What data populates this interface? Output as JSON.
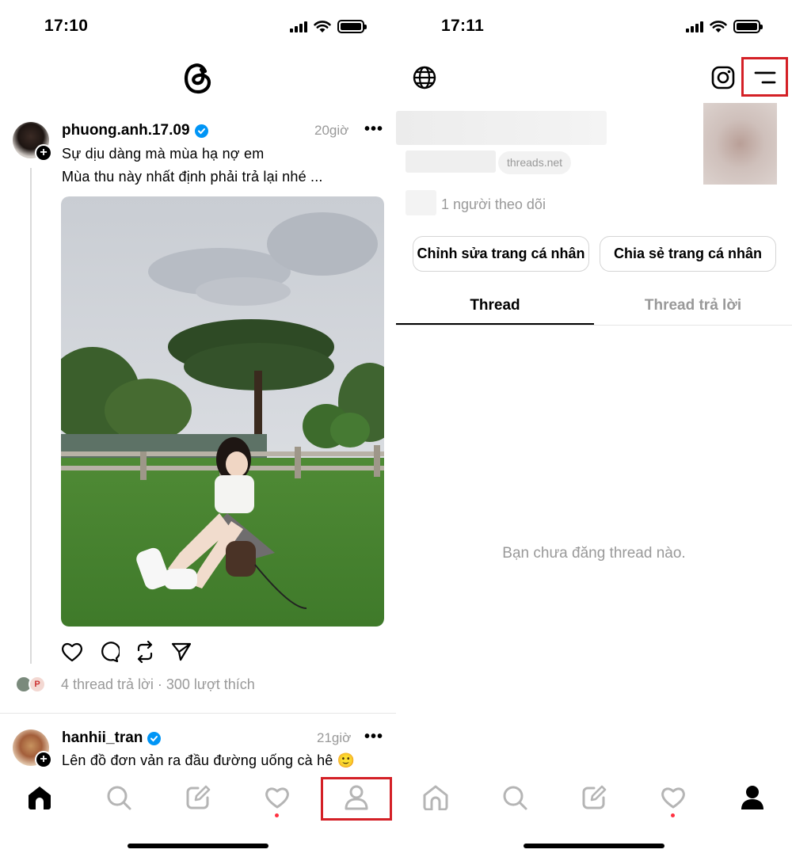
{
  "left": {
    "status_time": "17:10",
    "post1": {
      "username": "phuong.anh.17.09",
      "time": "20giờ",
      "more": "•••",
      "line1": "Sự dịu dàng mà mùa hạ nợ em",
      "line2": "Mùa thu này nhất định phải trả lại nhé ...",
      "meta": "4 thread trả lời · 300 lượt thích"
    },
    "post2": {
      "username": "hanhii_tran",
      "time": "21giờ",
      "more": "•••",
      "line1": "Lên đồ đơn vản ra đầu đường uống cà hê 🙂"
    }
  },
  "right": {
    "status_time": "17:11",
    "link_chip": "threads.net",
    "followers": "1 người theo dõi",
    "edit_profile": "Chỉnh sửa trang cá nhân",
    "share_profile": "Chia sẻ trang cá nhân",
    "tab_threads": "Thread",
    "tab_replies": "Thread trả lời",
    "empty_state": "Bạn chưa đăng thread nào."
  },
  "colors": {
    "accent_blue": "#0095f6",
    "highlight_red": "#d42026",
    "notification_red": "#ff3040",
    "muted_text": "#999999"
  }
}
